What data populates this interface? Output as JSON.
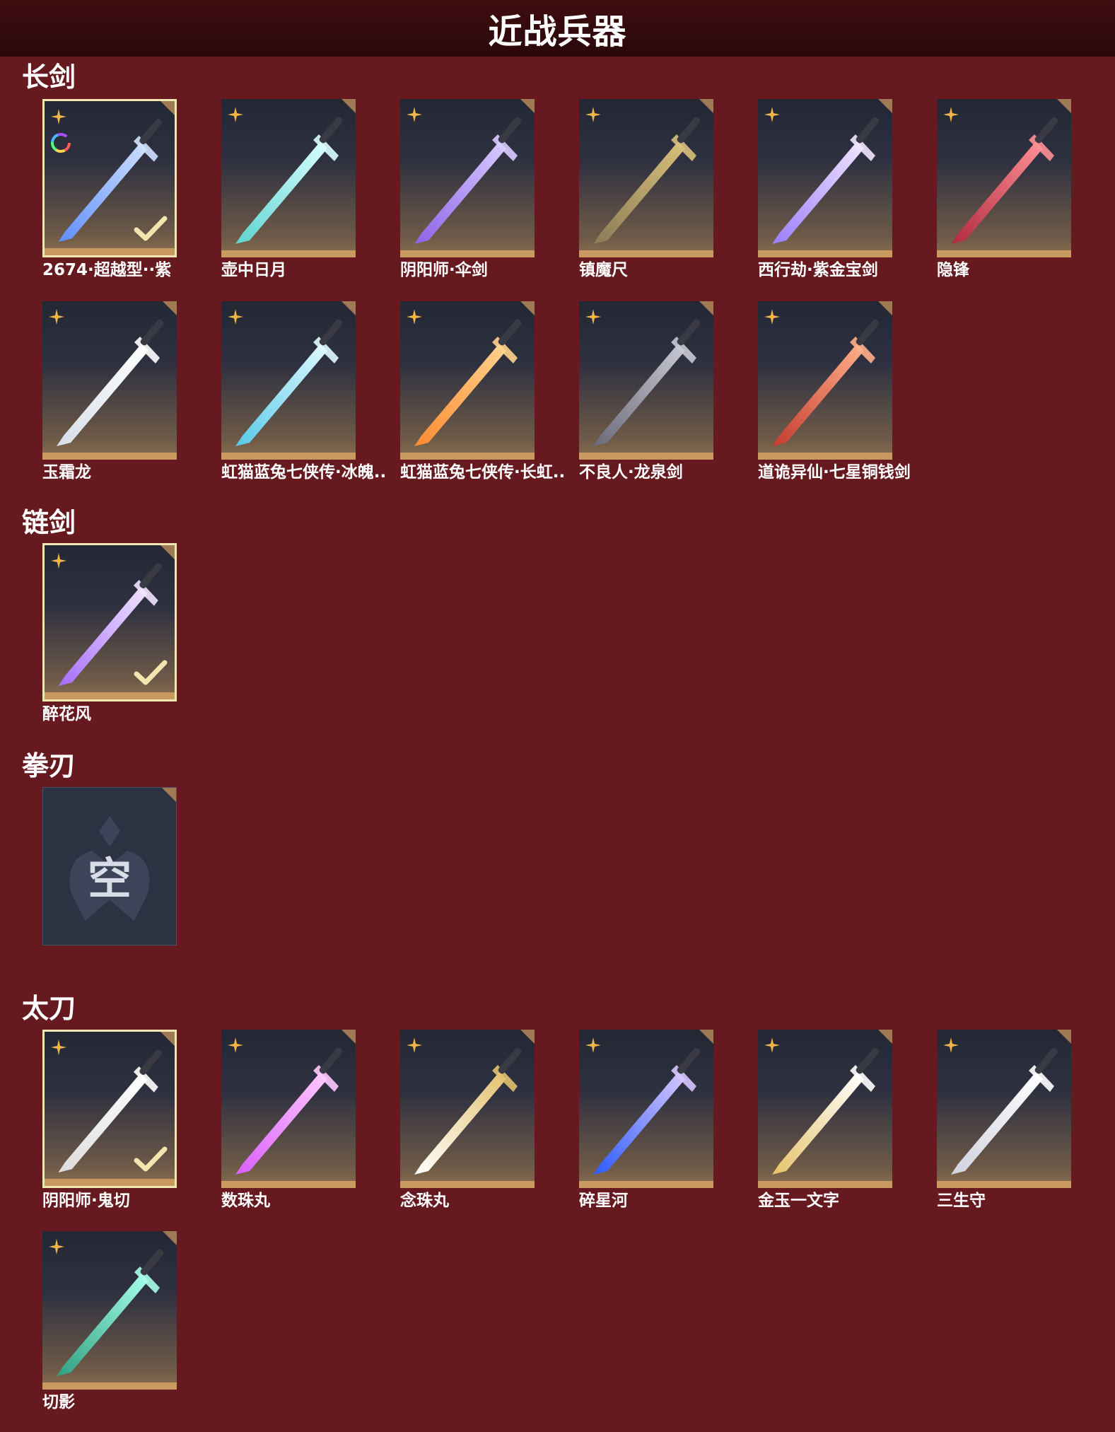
{
  "page_title": "近战兵器",
  "sections": {
    "longsword": {
      "title": "长剑",
      "items": [
        {
          "name": "2674·超越型··紫",
          "selected": true,
          "colored": true
        },
        {
          "name": "壶中日月"
        },
        {
          "name": "阴阳师·伞剑"
        },
        {
          "name": "镇魔尺"
        },
        {
          "name": "西行劫·紫金宝剑"
        },
        {
          "name": "隐锋"
        },
        {
          "name": "玉霜龙"
        },
        {
          "name": "虹猫蓝兔七侠传·冰魄.."
        },
        {
          "name": "虹猫蓝兔七侠传·长虹.."
        },
        {
          "name": "不良人·龙泉剑"
        },
        {
          "name": "道诡异仙·七星铜钱剑"
        }
      ]
    },
    "chainsword": {
      "title": "链剑",
      "items": [
        {
          "name": "醉花风",
          "selected": true
        }
      ]
    },
    "fistblade": {
      "title": "拳刃",
      "empty_label": "空"
    },
    "katana": {
      "title": "太刀",
      "items": [
        {
          "name": "阴阳师·鬼切",
          "selected": true
        },
        {
          "name": "数珠丸"
        },
        {
          "name": "念珠丸"
        },
        {
          "name": "碎星河"
        },
        {
          "name": "金玉一文字"
        },
        {
          "name": "三生守"
        },
        {
          "name": "切影"
        }
      ]
    }
  },
  "colors": {
    "background": "#661a1f",
    "header": "#2a080a",
    "rarity_icon": "#f2b54a",
    "selected_border": "#f2e6b0"
  }
}
